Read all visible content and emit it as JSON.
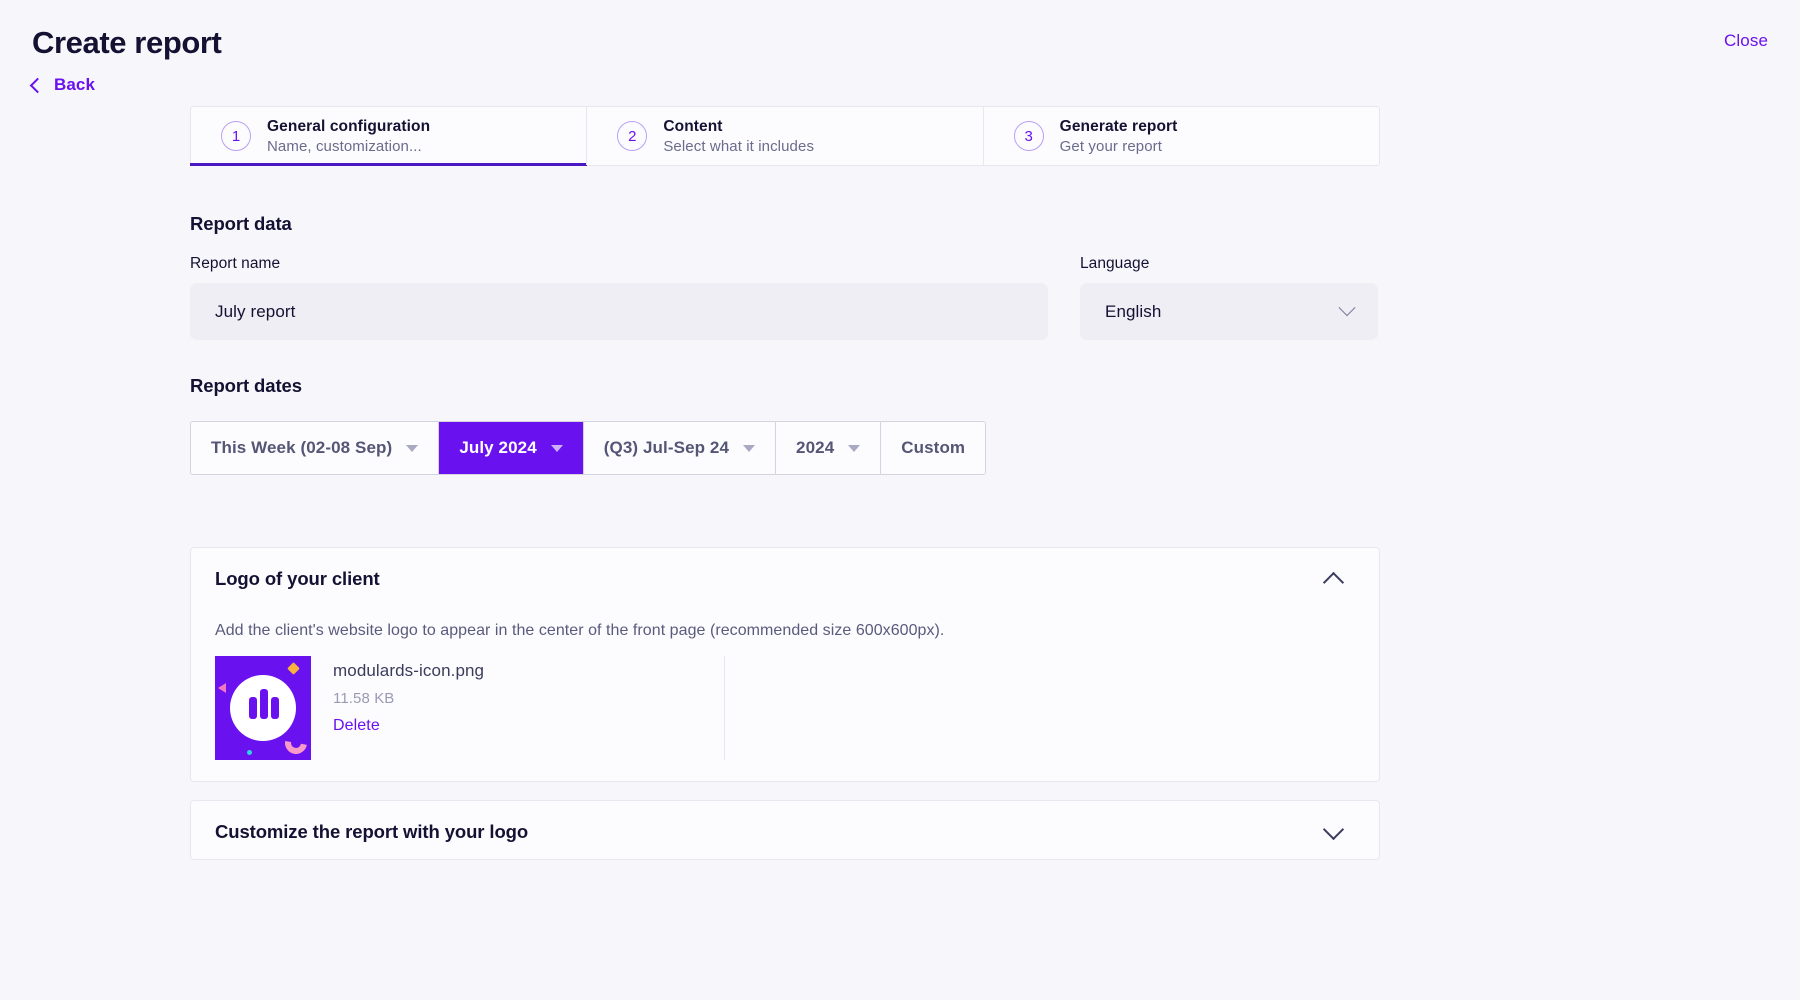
{
  "header": {
    "title": "Create report",
    "close_label": "Close",
    "back_label": "Back"
  },
  "stepper": {
    "steps": [
      {
        "num": "1",
        "title": "General configuration",
        "subtitle": "Name, customization...",
        "active": true
      },
      {
        "num": "2",
        "title": "Content",
        "subtitle": "Select what it includes",
        "active": false
      },
      {
        "num": "3",
        "title": "Generate report",
        "subtitle": "Get your report",
        "active": false
      }
    ]
  },
  "report_data": {
    "heading": "Report data",
    "name_label": "Report name",
    "name_value": "July report",
    "name_placeholder": "Report name",
    "language_label": "Language",
    "language_value": "English"
  },
  "report_dates": {
    "heading": "Report dates",
    "options": [
      {
        "label": "This Week (02-08 Sep)",
        "has_caret": true,
        "selected": false
      },
      {
        "label": "July 2024",
        "has_caret": true,
        "selected": true
      },
      {
        "label": "(Q3) Jul-Sep 24",
        "has_caret": true,
        "selected": false
      },
      {
        "label": "2024",
        "has_caret": true,
        "selected": false
      },
      {
        "label": "Custom",
        "has_caret": false,
        "selected": false
      }
    ]
  },
  "logo_client_card": {
    "title": "Logo of your client",
    "description": "Add the client's website logo to appear in the center of the front page (recommended size 600x600px).",
    "file": {
      "name": "modulards-icon.png",
      "size": "11.58 KB",
      "delete_label": "Delete"
    },
    "expanded": true
  },
  "customize_logo_card": {
    "title": "Customize the report with your logo",
    "expanded": false
  },
  "colors": {
    "accent": "#6a11f0",
    "accent_dark": "#4b19c4",
    "page_bg": "#f7f7fb",
    "card_bg": "#fcfcfe",
    "input_bg": "#eeeef4",
    "text_dark": "#141132",
    "text_muted": "#6b6b8c"
  }
}
